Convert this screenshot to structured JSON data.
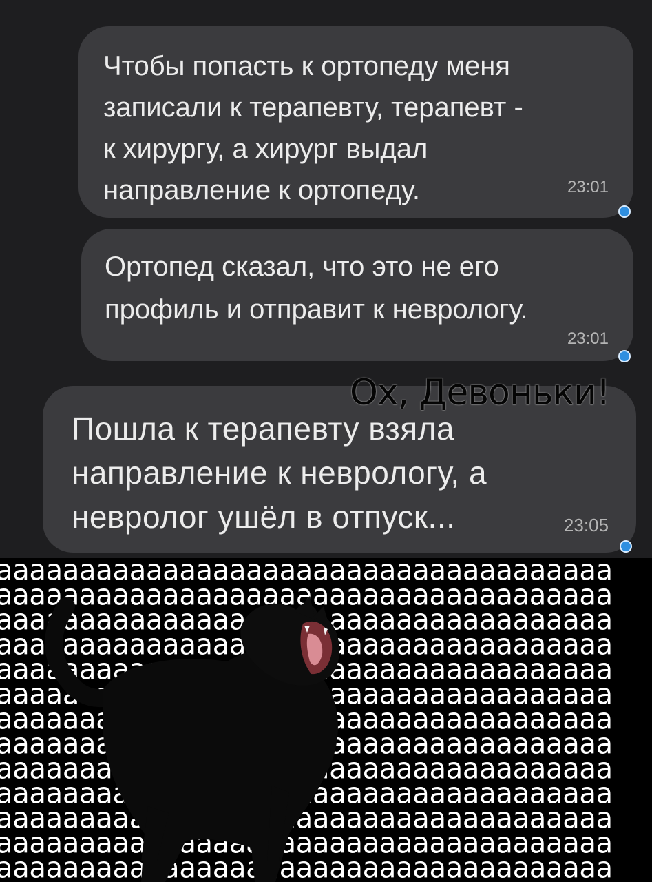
{
  "messages": [
    {
      "text": "Чтобы попасть к ортопеду меня\nзаписали к терапевту, терапевт -\nк хирургу, а хирург выдал\nнаправление к ортопеду.",
      "time": "23:01"
    },
    {
      "text": "Ортопед сказал, что это не его\nпрофиль и отправит к неврологу.",
      "time": "23:01"
    },
    {
      "text": "Пошла к терапевту взяла\nнаправление к неврологу, а\nневролог ушёл в отпуск...",
      "time": "23:05"
    }
  ],
  "caption": "Ох, Девоньки!",
  "meme": {
    "scream_lines": [
      "ааааааааааааааааааааааааааааааааааааа",
      "ааааааааааааааааааааааааааааааааааааа",
      "ааааааааааааааааааааааааааааааааааааа",
      "ааааааааааааааааааааааааааааааааааааа",
      "ааааааааааааааааааааааааааааааааааааа",
      "ааааааааааааааааааааааааааааааааааааа",
      "ааааааааааааааааааааааааааааааааааааа",
      "ааааааааааааааааааааааааааааааааааааа",
      "ааааааааааааааааааааааааааааааааааааа",
      "ааааааааааааааааааааааааааааааааааааа",
      "ааааааааааааааааааааааааааааааааааааа",
      "ааааааааааааааааааааааааааааааааааааа",
      "ааааааааааааааааааааааааааааааааааааа"
    ],
    "image": "screaming-black-cat"
  },
  "colors": {
    "background": "#1e1e20",
    "bubble": "#3b3b3e",
    "read_dot": "#2f8fe0"
  }
}
